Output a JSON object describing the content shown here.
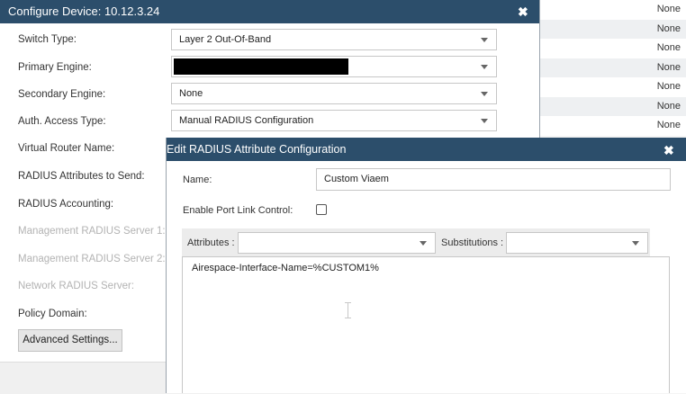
{
  "background_table": {
    "rows": [
      "None",
      "None",
      "None",
      "None",
      "None",
      "None",
      "None"
    ]
  },
  "configure_dialog": {
    "title": "Configure Device: 10.12.3.24",
    "close_glyph": "✖",
    "fields": {
      "switch_type_label": "Switch Type:",
      "switch_type_value": "Layer 2 Out-Of-Band",
      "primary_engine_label": "Primary Engine:",
      "secondary_engine_label": "Secondary Engine:",
      "secondary_engine_value": "None",
      "auth_access_label": "Auth. Access Type:",
      "auth_access_value": "Manual RADIUS Configuration",
      "virtual_router_label": "Virtual Router Name:",
      "radius_attrs_label": "RADIUS Attributes to Send:",
      "radius_accounting_label": "RADIUS Accounting:",
      "mgmt_radius1_label": "Management RADIUS Server 1:",
      "mgmt_radius2_label": "Management RADIUS Server 2:",
      "network_radius_label": "Network RADIUS Server:",
      "policy_domain_label": "Policy Domain:"
    },
    "advanced_button": "Advanced Settings..."
  },
  "radius_dialog": {
    "title": "Edit RADIUS Attribute Configuration",
    "close_glyph": "✖",
    "name_label": "Name:",
    "name_value": "Custom Viaem",
    "port_link_label": "Enable Port Link Control:",
    "port_link_checked": false,
    "attributes_label": "Attributes :",
    "attributes_value": "",
    "substitutions_label": "Substitutions :",
    "substitutions_value": "",
    "attribute_text": "Airespace-Interface-Name=%CUSTOM1%"
  },
  "colors": {
    "titlebar": "#2c4e6b",
    "dialog_bg": "#ffffff",
    "disabled_text": "#b3b3b3"
  }
}
